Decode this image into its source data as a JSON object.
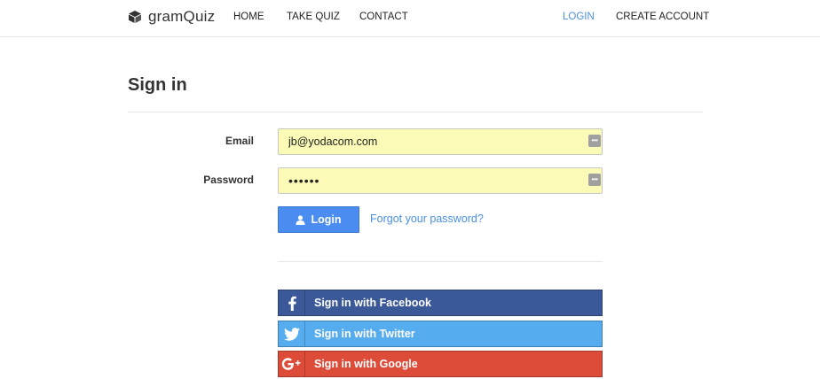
{
  "brand": {
    "name": "gramQuiz",
    "icon": "cube-icon"
  },
  "nav": {
    "home": "HOME",
    "take_quiz": "TAKE QUIZ",
    "contact": "CONTACT",
    "login": "LOGIN",
    "create_account": "CREATE ACCOUNT"
  },
  "colors": {
    "accent": "#4a90e2",
    "autofill_bg": "#fbfbb7",
    "facebook": "#3b5998",
    "twitter": "#55acee",
    "google": "#dd4b39"
  },
  "signin": {
    "title": "Sign in",
    "email_label": "Email",
    "email_value": "jb@yodacom.com",
    "password_label": "Password",
    "password_value": "••••••",
    "login_button": "Login",
    "forgot_link": "Forgot your password?"
  },
  "social": {
    "facebook": {
      "label": "Sign in with Facebook",
      "icon": "facebook-icon"
    },
    "twitter": {
      "label": "Sign in with Twitter",
      "icon": "twitter-icon"
    },
    "google": {
      "label": "Sign in with Google",
      "icon": "google-plus-icon"
    }
  }
}
